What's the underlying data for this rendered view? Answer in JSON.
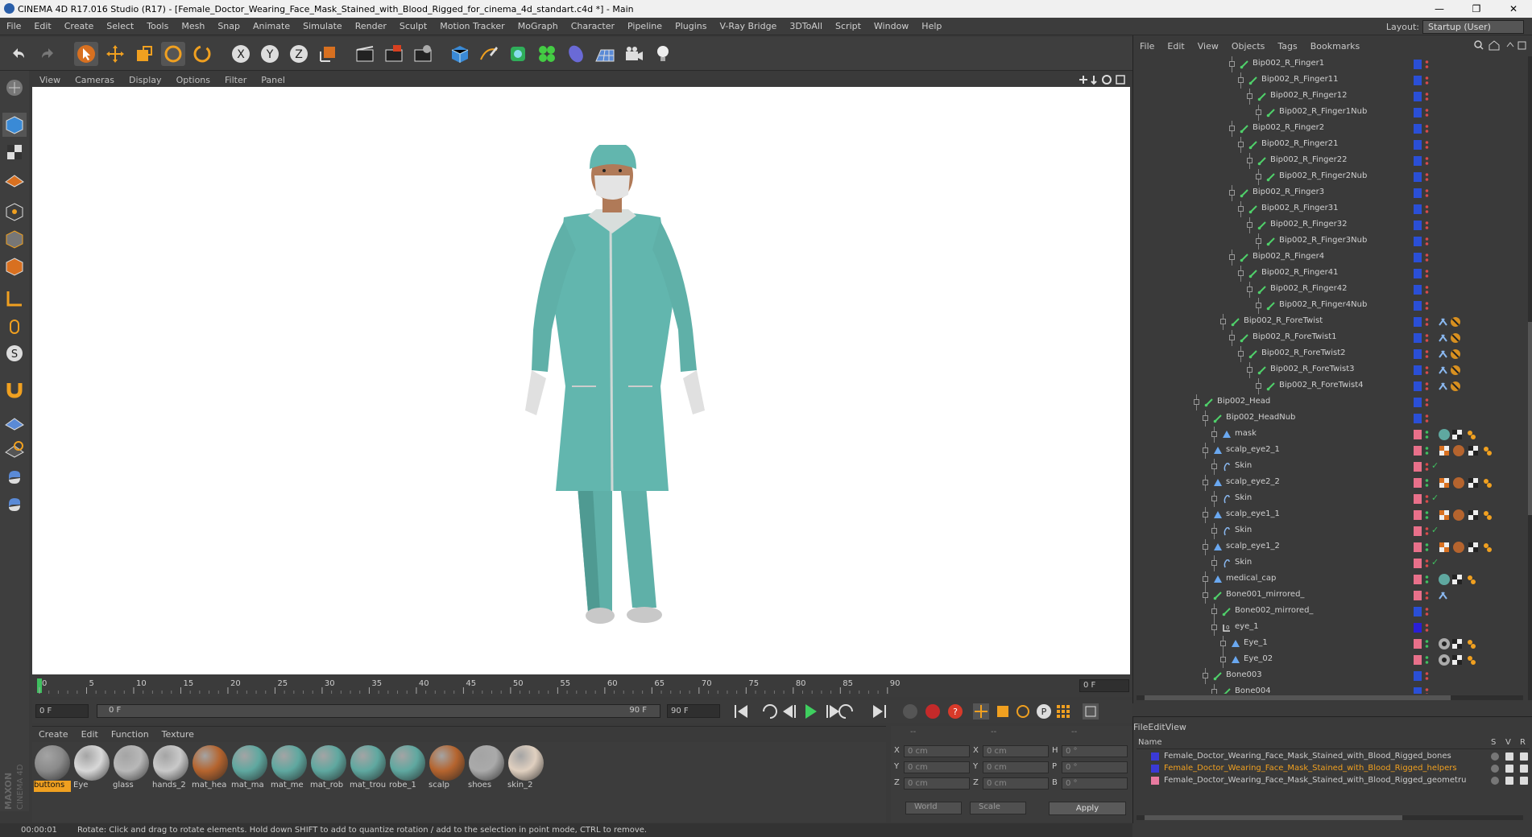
{
  "window": {
    "title": "CINEMA 4D R17.016 Studio (R17) - [Female_Doctor_Wearing_Face_Mask_Stained_with_Blood_Rigged_for_cinema_4d_standart.c4d *] - Main",
    "controls": [
      "—",
      "❐",
      "✕"
    ]
  },
  "menubar": [
    "File",
    "Edit",
    "Create",
    "Select",
    "Tools",
    "Mesh",
    "Snap",
    "Animate",
    "Simulate",
    "Render",
    "Sculpt",
    "Motion Tracker",
    "MoGraph",
    "Character",
    "Pipeline",
    "Plugins",
    "V-Ray Bridge",
    "3DToAll",
    "Script",
    "Window",
    "Help"
  ],
  "layout": {
    "label": "Layout:",
    "value": "Startup (User)"
  },
  "viewport": {
    "menu": [
      "View",
      "Cameras",
      "Display",
      "Options",
      "Filter",
      "Panel"
    ]
  },
  "timeline": {
    "ticks": [
      "0",
      "5",
      "10",
      "15",
      "20",
      "25",
      "30",
      "35",
      "40",
      "45",
      "50",
      "55",
      "60",
      "65",
      "70",
      "75",
      "80",
      "85",
      "90"
    ],
    "end_field": "0 F",
    "start": "0 F",
    "range_start": "0 F",
    "range_end": "90 F",
    "end": "90 F"
  },
  "material_manager": {
    "menu": [
      "Create",
      "Edit",
      "Function",
      "Texture"
    ],
    "materials": [
      {
        "name": "buttons",
        "color": "#8a8a8a",
        "selected": true
      },
      {
        "name": "Eye",
        "color": "#d8d8d8"
      },
      {
        "name": "glass",
        "color": "#b8b8b8"
      },
      {
        "name": "hands_2",
        "color": "#c9c9c9"
      },
      {
        "name": "mat_hea",
        "color": "#b5642e"
      },
      {
        "name": "mat_ma",
        "color": "#5fa8a0"
      },
      {
        "name": "mat_me",
        "color": "#5fa8a0"
      },
      {
        "name": "mat_rob",
        "color": "#5fa8a0"
      },
      {
        "name": "mat_trou",
        "color": "#5fa8a0"
      },
      {
        "name": "robe_1",
        "color": "#5fa8a0"
      },
      {
        "name": "scalp",
        "color": "#b5642e"
      },
      {
        "name": "shoes",
        "color": "#aaaaaa"
      },
      {
        "name": "skin_2",
        "color": "#e0d0c0"
      }
    ]
  },
  "coords": {
    "headers": [
      "--",
      "--",
      "--"
    ],
    "rows": [
      {
        "a": "X",
        "av": "0 cm",
        "b": "X",
        "bv": "0 cm",
        "c": "H",
        "cv": "0 °"
      },
      {
        "a": "Y",
        "av": "0 cm",
        "b": "Y",
        "bv": "0 cm",
        "c": "P",
        "cv": "0 °"
      },
      {
        "a": "Z",
        "av": "0 cm",
        "b": "Z",
        "bv": "0 cm",
        "c": "B",
        "cv": "0 °"
      }
    ],
    "space": "World",
    "mode": "Scale",
    "apply": "Apply"
  },
  "status": {
    "time": "00:00:01",
    "message": "Rotate: Click and drag to rotate elements. Hold down SHIFT to add to quantize rotation / add to the selection in point mode, CTRL to remove."
  },
  "object_manager": {
    "menu": [
      "File",
      "Edit",
      "View",
      "Objects",
      "Tags",
      "Bookmarks"
    ],
    "rows": [
      {
        "name": "Bip002_R_Finger1",
        "depth": 14,
        "type": "bone",
        "swatch": "#2a4fd6"
      },
      {
        "name": "Bip002_R_Finger11",
        "depth": 15,
        "type": "bone",
        "swatch": "#2a4fd6"
      },
      {
        "name": "Bip002_R_Finger12",
        "depth": 16,
        "type": "bone",
        "swatch": "#2a4fd6"
      },
      {
        "name": "Bip002_R_Finger1Nub",
        "depth": 17,
        "type": "bone",
        "swatch": "#2a4fd6"
      },
      {
        "name": "Bip002_R_Finger2",
        "depth": 14,
        "type": "bone",
        "swatch": "#2a4fd6"
      },
      {
        "name": "Bip002_R_Finger21",
        "depth": 15,
        "type": "bone",
        "swatch": "#2a4fd6"
      },
      {
        "name": "Bip002_R_Finger22",
        "depth": 16,
        "type": "bone",
        "swatch": "#2a4fd6"
      },
      {
        "name": "Bip002_R_Finger2Nub",
        "depth": 17,
        "type": "bone",
        "swatch": "#2a4fd6"
      },
      {
        "name": "Bip002_R_Finger3",
        "depth": 14,
        "type": "bone",
        "swatch": "#2a4fd6"
      },
      {
        "name": "Bip002_R_Finger31",
        "depth": 15,
        "type": "bone",
        "swatch": "#2a4fd6"
      },
      {
        "name": "Bip002_R_Finger32",
        "depth": 16,
        "type": "bone",
        "swatch": "#2a4fd6"
      },
      {
        "name": "Bip002_R_Finger3Nub",
        "depth": 17,
        "type": "bone",
        "swatch": "#2a4fd6"
      },
      {
        "name": "Bip002_R_Finger4",
        "depth": 14,
        "type": "bone",
        "swatch": "#2a4fd6"
      },
      {
        "name": "Bip002_R_Finger41",
        "depth": 15,
        "type": "bone",
        "swatch": "#2a4fd6"
      },
      {
        "name": "Bip002_R_Finger42",
        "depth": 16,
        "type": "bone",
        "swatch": "#2a4fd6"
      },
      {
        "name": "Bip002_R_Finger4Nub",
        "depth": 17,
        "type": "bone",
        "swatch": "#2a4fd6"
      },
      {
        "name": "Bip002_R_ForeTwist",
        "depth": 13,
        "type": "bone",
        "swatch": "#2a4fd6",
        "tags": "twist"
      },
      {
        "name": "Bip002_R_ForeTwist1",
        "depth": 14,
        "type": "bone",
        "swatch": "#2a4fd6",
        "tags": "twist"
      },
      {
        "name": "Bip002_R_ForeTwist2",
        "depth": 15,
        "type": "bone",
        "swatch": "#2a4fd6",
        "tags": "twist"
      },
      {
        "name": "Bip002_R_ForeTwist3",
        "depth": 16,
        "type": "bone",
        "swatch": "#2a4fd6",
        "tags": "twist"
      },
      {
        "name": "Bip002_R_ForeTwist4",
        "depth": 17,
        "type": "bone",
        "swatch": "#2a4fd6",
        "tags": "twist"
      },
      {
        "name": "Bip002_Head",
        "depth": 10,
        "type": "bone",
        "swatch": "#2a4fd6"
      },
      {
        "name": "Bip002_HeadNub",
        "depth": 11,
        "type": "bone",
        "swatch": "#2a4fd6"
      },
      {
        "name": "mask",
        "depth": 12,
        "type": "mesh",
        "swatch": "#e8708a",
        "tags": "mat"
      },
      {
        "name": "scalp_eye2_1",
        "depth": 11,
        "type": "mesh",
        "swatch": "#e8708a",
        "tags": "mat2"
      },
      {
        "name": "Skin",
        "depth": 12,
        "type": "skin",
        "swatch": "#e8708a",
        "check": true
      },
      {
        "name": "scalp_eye2_2",
        "depth": 11,
        "type": "mesh",
        "swatch": "#e8708a",
        "tags": "mat2"
      },
      {
        "name": "Skin",
        "depth": 12,
        "type": "skin",
        "swatch": "#e8708a",
        "check": true
      },
      {
        "name": "scalp_eye1_1",
        "depth": 11,
        "type": "mesh",
        "swatch": "#e8708a",
        "tags": "mat2"
      },
      {
        "name": "Skin",
        "depth": 12,
        "type": "skin",
        "swatch": "#e8708a",
        "check": true
      },
      {
        "name": "scalp_eye1_2",
        "depth": 11,
        "type": "mesh",
        "swatch": "#e8708a",
        "tags": "mat2"
      },
      {
        "name": "Skin",
        "depth": 12,
        "type": "skin",
        "swatch": "#e8708a",
        "check": true
      },
      {
        "name": "medical_cap",
        "depth": 11,
        "type": "mesh",
        "swatch": "#e8708a",
        "tags": "mat"
      },
      {
        "name": "Bone001_mirrored_",
        "depth": 11,
        "type": "bone",
        "swatch": "#e8708a",
        "tags": "ik"
      },
      {
        "name": "Bone002_mirrored_",
        "depth": 12,
        "type": "bone",
        "swatch": "#2a4fd6"
      },
      {
        "name": "eye_1",
        "depth": 12,
        "type": "null",
        "swatch": "#2a1fd6"
      },
      {
        "name": "Eye_1",
        "depth": 13,
        "type": "mesh",
        "swatch": "#e8708a",
        "tags": "eye"
      },
      {
        "name": "Eye_02",
        "depth": 13,
        "type": "mesh",
        "swatch": "#e8708a",
        "tags": "eye"
      },
      {
        "name": "Bone003",
        "depth": 11,
        "type": "bone",
        "swatch": "#2a4fd6"
      },
      {
        "name": "Bone004",
        "depth": 12,
        "type": "bone",
        "swatch": "#2a4fd6"
      }
    ]
  },
  "layer_manager": {
    "menu": [
      "File",
      "Edit",
      "View"
    ],
    "header": {
      "name": "Name",
      "s": "S",
      "v": "V",
      "r": "R"
    },
    "layers": [
      {
        "name": "Female_Doctor_Wearing_Face_Mask_Stained_with_Blood_Rigged_bones",
        "color": "#3a3ad6",
        "highlight": false
      },
      {
        "name": "Female_Doctor_Wearing_Face_Mask_Stained_with_Blood_Rigged_helpers",
        "color": "#3a3ad6",
        "highlight": true
      },
      {
        "name": "Female_Doctor_Wearing_Face_Mask_Stained_with_Blood_Rigged_geometru",
        "color": "#e87aa0",
        "highlight": false
      }
    ]
  },
  "branding": "MAXON CINEMA 4D"
}
